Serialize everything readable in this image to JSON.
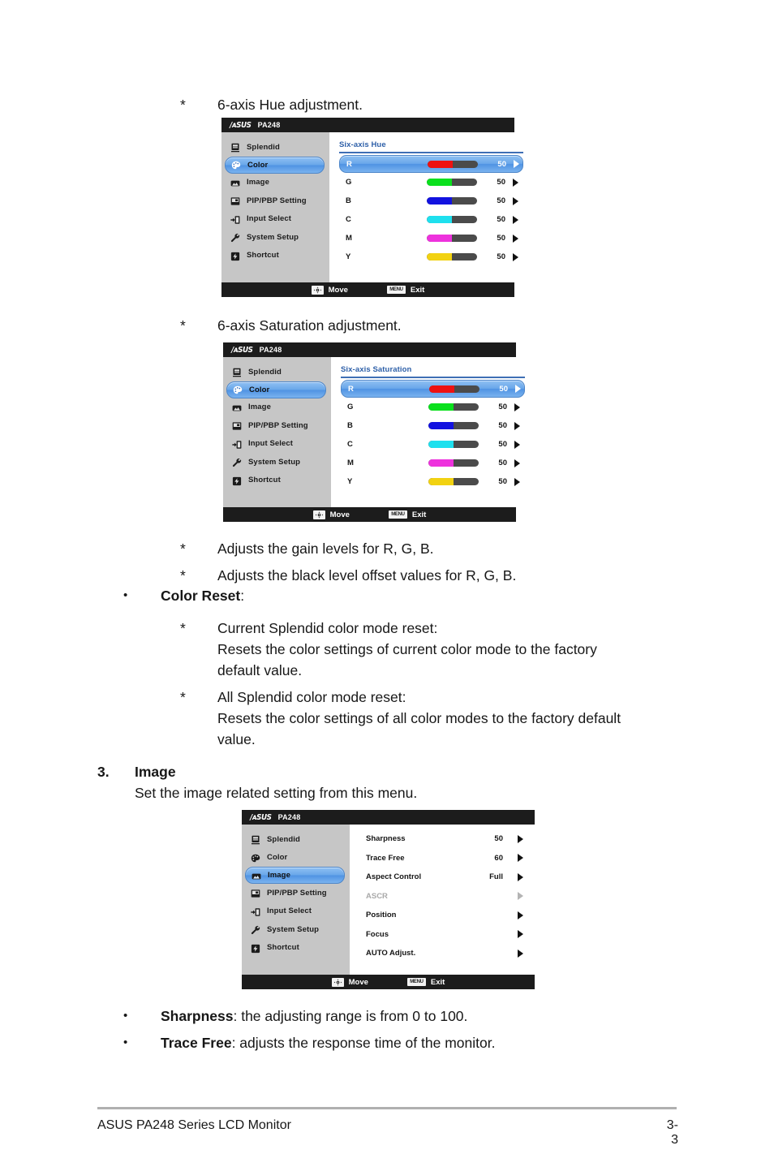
{
  "document": {
    "footer_left": "ASUS PA248 Series LCD Monitor",
    "footer_page": "3-3"
  },
  "body_text": {
    "hue_note": {
      "mark": "*",
      "text": "6-axis Hue adjustment."
    },
    "saturation_note": {
      "mark": "*",
      "text": "6-axis Saturation adjustment."
    },
    "gain_note": {
      "mark": "*",
      "text": "Adjusts the gain levels for R, G, B."
    },
    "black_level_note": {
      "mark": "*",
      "text": "Adjusts the black level offset values for R, G, B."
    },
    "color_reset": {
      "mark": "•",
      "label": "Color Reset",
      "suffix": ":"
    },
    "current_reset": {
      "mark": "*",
      "line1": "Current Splendid color mode reset:",
      "line2": "Resets the color settings of current color mode to the factory",
      "line3": "default value."
    },
    "all_reset": {
      "mark": "*",
      "line1": "All Splendid color mode reset:",
      "line2": "Resets the color settings of all color modes to the factory default",
      "line3": "value."
    },
    "section3": {
      "number": "3.",
      "title": "Image",
      "subtitle": "Set the image related setting from this menu."
    },
    "sharpness_note": {
      "mark": "•",
      "label": "Sharpness",
      "text": ": the adjusting range is from 0 to 100."
    },
    "trace_free_note": {
      "mark": "•",
      "label": "Trace Free",
      "text": ": adjusts the response time of the monitor."
    }
  },
  "osd_common": {
    "logo": "/ᴀSUS",
    "model": "PA248",
    "footer_move_key_icon": "joystick-icon",
    "footer_move_label": "Move",
    "footer_menu_key_label": "MENU",
    "footer_exit_label": "Exit",
    "sidebar": [
      {
        "label": "Splendid",
        "icon": "splendid-icon",
        "active": false
      },
      {
        "label": "Color",
        "icon": "palette-icon",
        "active": true
      },
      {
        "label": "Image",
        "icon": "image-icon",
        "active": false
      },
      {
        "label": "PIP/PBP Setting",
        "icon": "pip-pbp-icon",
        "active": false
      },
      {
        "label": "Input Select",
        "icon": "input-select-icon",
        "active": false
      },
      {
        "label": "System Setup",
        "icon": "wrench-icon",
        "active": false
      },
      {
        "label": "Shortcut",
        "icon": "shortcut-icon",
        "active": false
      }
    ],
    "sidebar_image_active": [
      {
        "label": "Splendid",
        "icon": "splendid-icon",
        "active": false
      },
      {
        "label": "Color",
        "icon": "palette-icon",
        "active": false
      },
      {
        "label": "Image",
        "icon": "image-icon",
        "active": true
      },
      {
        "label": "PIP/PBP Setting",
        "icon": "pip-pbp-icon",
        "active": false
      },
      {
        "label": "Input Select",
        "icon": "input-select-icon",
        "active": false
      },
      {
        "label": "System Setup",
        "icon": "wrench-icon",
        "active": false
      },
      {
        "label": "Shortcut",
        "icon": "shortcut-icon",
        "active": false
      }
    ]
  },
  "osd_hue": {
    "header": "Six-axis Hue",
    "rows": [
      {
        "channel": "R",
        "value": "50",
        "fill_pct": 50,
        "color": "#ee1111",
        "selected": true
      },
      {
        "channel": "G",
        "value": "50",
        "fill_pct": 50,
        "color": "#0ae01d",
        "selected": false
      },
      {
        "channel": "B",
        "value": "50",
        "fill_pct": 50,
        "color": "#1212e0",
        "selected": false
      },
      {
        "channel": "C",
        "value": "50",
        "fill_pct": 50,
        "color": "#1ee0ee",
        "selected": false
      },
      {
        "channel": "M",
        "value": "50",
        "fill_pct": 50,
        "color": "#ee32dd",
        "selected": false
      },
      {
        "channel": "Y",
        "value": "50",
        "fill_pct": 50,
        "color": "#f2d211",
        "selected": false
      }
    ]
  },
  "osd_saturation": {
    "header": "Six-axis Saturation",
    "rows": [
      {
        "channel": "R",
        "value": "50",
        "fill_pct": 50,
        "color": "#ee1111",
        "selected": true
      },
      {
        "channel": "G",
        "value": "50",
        "fill_pct": 50,
        "color": "#0ae01d",
        "selected": false
      },
      {
        "channel": "B",
        "value": "50",
        "fill_pct": 50,
        "color": "#1212e0",
        "selected": false
      },
      {
        "channel": "C",
        "value": "50",
        "fill_pct": 50,
        "color": "#1ee0ee",
        "selected": false
      },
      {
        "channel": "M",
        "value": "50",
        "fill_pct": 50,
        "color": "#ee32dd",
        "selected": false
      },
      {
        "channel": "Y",
        "value": "50",
        "fill_pct": 50,
        "color": "#f2d211",
        "selected": false
      }
    ]
  },
  "osd_image": {
    "rows": [
      {
        "name": "Sharpness",
        "value": "50",
        "dim": false
      },
      {
        "name": "Trace Free",
        "value": "60",
        "dim": false
      },
      {
        "name": "Aspect Control",
        "value": "Full",
        "dim": false
      },
      {
        "name": "ASCR",
        "value": "",
        "dim": true
      },
      {
        "name": "Position",
        "value": "",
        "dim": false
      },
      {
        "name": "Focus",
        "value": "",
        "dim": false
      },
      {
        "name": "AUTO Adjust.",
        "value": "",
        "dim": false
      }
    ]
  },
  "colors": {
    "osd_title_bar": "#1c1c1c",
    "osd_sidebar": "#c6c6c6",
    "highlight_blue": "#4f93e3",
    "header_blue": "#2d5fa8",
    "track_gray": "#4b4b4b"
  }
}
